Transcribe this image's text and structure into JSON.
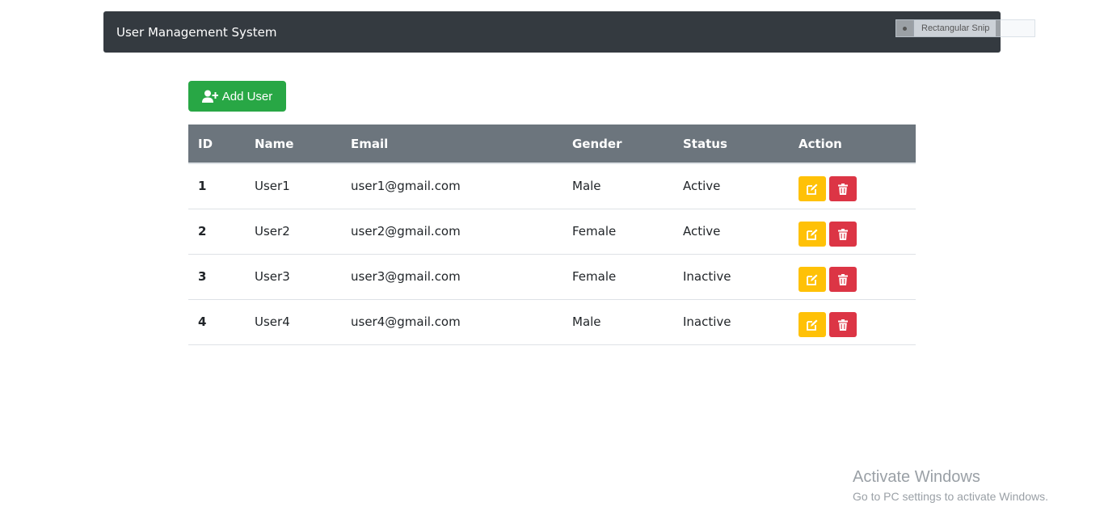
{
  "navbar": {
    "brand": "User Management System"
  },
  "snip_tool": {
    "label": "Rectangular Snip"
  },
  "toolbar": {
    "add_user_label": "Add User",
    "add_user_icon": "user-plus-icon"
  },
  "table": {
    "headers": [
      "ID",
      "Name",
      "Email",
      "Gender",
      "Status",
      "Action"
    ],
    "rows": [
      {
        "id": "1",
        "name": "User1",
        "email": "user1@gmail.com",
        "gender": "Male",
        "status": "Active"
      },
      {
        "id": "2",
        "name": "User2",
        "email": "user2@gmail.com",
        "gender": "Female",
        "status": "Active"
      },
      {
        "id": "3",
        "name": "User3",
        "email": "user3@gmail.com",
        "gender": "Female",
        "status": "Inactive"
      },
      {
        "id": "4",
        "name": "User4",
        "email": "user4@gmail.com",
        "gender": "Male",
        "status": "Inactive"
      }
    ],
    "action_icons": {
      "edit": "edit-icon",
      "delete": "trash-icon"
    }
  },
  "watermark": {
    "line1": "Activate Windows",
    "line2": "Go to PC settings to activate Windows."
  },
  "colors": {
    "navbar_bg": "#343a40",
    "header_bg": "#6c757d",
    "success": "#28a745",
    "warning": "#ffc107",
    "danger": "#dc3545"
  }
}
